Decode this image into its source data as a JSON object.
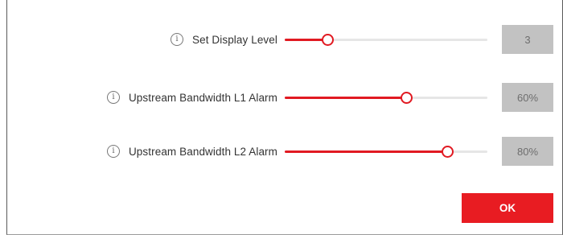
{
  "colors": {
    "accent": "#e11a22",
    "track": "#e6e6e6",
    "value_box_bg": "#c2c2c2",
    "value_box_text": "#6e6e6e",
    "ok_button_bg": "#e81c22"
  },
  "icons": {
    "info": "info-circle-icon"
  },
  "info_glyph": "i",
  "settings": [
    {
      "label": "Set Display Level",
      "value": "3",
      "slider_level": 0.21
    },
    {
      "label": "Upstream Bandwidth L1 Alarm",
      "value": "60%",
      "slider_level": 0.6
    },
    {
      "label": "Upstream Bandwidth L2 Alarm",
      "value": "80%",
      "slider_level": 0.8
    }
  ],
  "ok_label": "OK"
}
